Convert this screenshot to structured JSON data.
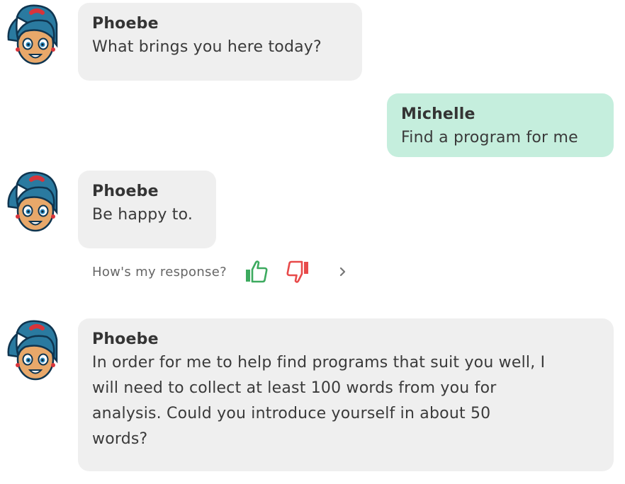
{
  "messages": [
    {
      "role": "bot",
      "sender": "Phoebe",
      "lines": [
        "What brings you here today?"
      ]
    },
    {
      "role": "user",
      "sender": "Michelle",
      "lines": [
        "Find a program for me"
      ]
    },
    {
      "role": "bot",
      "sender": "Phoebe",
      "lines": [
        "Be happy to."
      ]
    },
    {
      "role": "bot",
      "sender": "Phoebe",
      "lines": [
        "In order for me to help find programs that suit you well, I",
        "will need to collect at least 100 words from you for",
        "analysis. Could you introduce yourself in about 50",
        "words?"
      ]
    }
  ],
  "feedback": {
    "label": "How's my response?",
    "icons": [
      "thumbs-up-icon",
      "thumbs-down-icon",
      "chevron-right-icon"
    ],
    "colors": {
      "thumbs_up": "#3daa5f",
      "thumbs_down": "#e84a4a",
      "chevron": "#777777"
    }
  },
  "colors": {
    "bot_bubble": "#efefef",
    "user_bubble": "#c5eedd",
    "avatar_hair": "#2a7aa0",
    "avatar_skin": "#e8a86a"
  }
}
